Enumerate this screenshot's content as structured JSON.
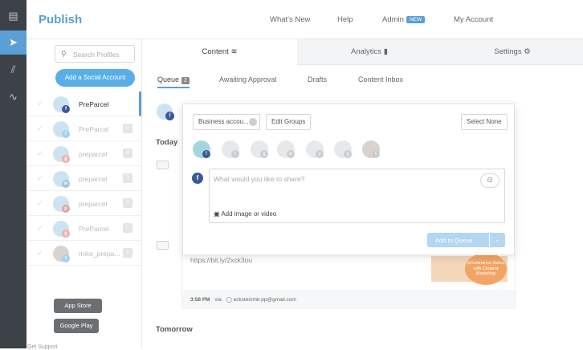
{
  "header": {
    "brand": "Publish",
    "nav": [
      "What's New",
      "Help",
      "Admin",
      "My Account"
    ],
    "admin_badge": "NEW"
  },
  "sidebar": {
    "search_placeholder": "Search Profiles",
    "add_button": "Add a Social Account",
    "profiles": [
      {
        "name": "PreParcel",
        "network": "facebook",
        "count": ""
      },
      {
        "name": "PreParcel",
        "network": "twitter",
        "count": "0"
      },
      {
        "name": "preparcel",
        "network": "google",
        "count": "0"
      },
      {
        "name": "preparcel",
        "network": "linkedin",
        "count": "0"
      },
      {
        "name": "preparcel",
        "network": "pinterest",
        "count": "0"
      },
      {
        "name": "PreParcel",
        "network": "google",
        "count": "0"
      },
      {
        "name": "mike_prepa...",
        "network": "twitter",
        "count": "0"
      }
    ],
    "app_store": "App Store",
    "google_play": "Google Play",
    "support": "Get Support"
  },
  "tabs": {
    "content": "Content",
    "analytics": "Analytics",
    "settings": "Settings"
  },
  "subnav": {
    "queue": "Queue",
    "queue_count": "2",
    "awaiting": "Awaiting Approval",
    "drafts": "Drafts",
    "inbox": "Content Inbox"
  },
  "sections": {
    "today": "Today",
    "tomorrow": "Tomorrow"
  },
  "composer": {
    "account_select": "Business accou...",
    "edit_groups": "Edit Groups",
    "select_none": "Select None",
    "placeholder": "What would you like to share?",
    "add_media": "Add image or video",
    "add_to_queue": "Add to Queue"
  },
  "post": {
    "link": "https://bit.ly/2xck3ou",
    "meta_time": "3:58 PM",
    "meta_via": "via",
    "meta_user": "ecksteinmk-pp@gmail.com",
    "thumb_text": "eCommerce Sales with Content Marketing"
  },
  "colors": {
    "accent": "#5a9fd6",
    "rail": "#3d4248",
    "facebook": "#3b5998"
  }
}
